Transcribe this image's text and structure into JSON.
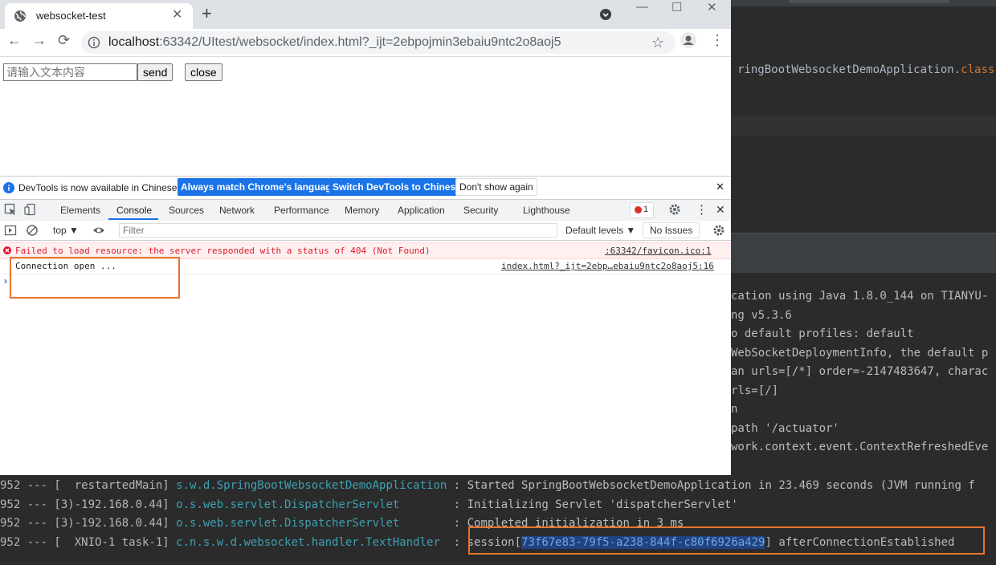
{
  "browser": {
    "tab_title": "websocket-test",
    "tab_close": "✕",
    "new_tab": "+",
    "url_host": "localhost",
    "url_rest": ":63342/UItest/websocket/index.html?_ijt=2ebpojmin3ebaiu9ntc2o8aoj5",
    "window_controls": {
      "minimize": "—",
      "maximize": "☐",
      "close": "✕"
    },
    "nav": {
      "back": "←",
      "forward": "→",
      "reload": "⟳",
      "star": "☆",
      "menu": "⋮"
    }
  },
  "page": {
    "input_placeholder": "请输入文本内容",
    "send_label": "send",
    "close_label": "close"
  },
  "devtools": {
    "info_text": "DevTools is now available in Chinese!",
    "btn_match": "Always match Chrome's language",
    "btn_switch": "Switch DevTools to Chinese",
    "btn_dont_show": "Don't show again",
    "info_close": "✕",
    "tabs": [
      "Elements",
      "Console",
      "Sources",
      "Network",
      "Performance",
      "Memory",
      "Application",
      "Security",
      "Lighthouse"
    ],
    "error_count": "1",
    "context": "top ▼",
    "filter_placeholder": "Filter",
    "levels": "Default levels ▼",
    "no_issues": "No Issues",
    "close": "✕",
    "menu": "⋮",
    "console": {
      "error_text": "Failed to load resource: the server responded with a status of 404 (Not Found)",
      "error_src": ":63342/favicon.ico:1",
      "log_text": "Connection open ...",
      "log_src": "index.html?_ijt=2ebp…ebaiu9ntc2o8aoj5:16",
      "prompt": "›"
    }
  },
  "ide": {
    "code_line": {
      "text": "ringBootWebsocketDemoApplication.",
      "keyword": "class,"
    },
    "right_log_fragments": [
      "cation using Java 1.8.0_144 on TIANYU-",
      "ng v5.3.6",
      "o default profiles: default",
      "WebSocketDeploymentInfo, the default p",
      "an urls=[/*] order=-2147483647, charac",
      "rls=[/]",
      "n",
      "path '/actuator'",
      "work.context.event.ContextRefreshedEve"
    ],
    "bottom_logs": [
      {
        "pid": "952 --- [  restartedMain] ",
        "logger": "s.w.d.SpringBootWebsocketDemoApplication",
        "msg": " : Started SpringBootWebsocketDemoApplication in 23.469 seconds (JVM running f"
      },
      {
        "pid": "952 --- [3)-192.168.0.44] ",
        "logger": "o.s.web.servlet.DispatcherServlet       ",
        "msg": " : Initializing Servlet 'dispatcherServlet'"
      },
      {
        "pid": "952 --- [3)-192.168.0.44] ",
        "logger": "o.s.web.servlet.DispatcherServlet       ",
        "msg": " : Completed initialization in 3 ms"
      }
    ],
    "session_log": {
      "pid": "952 --- [  XNIO-1 task-1] ",
      "logger": "c.n.s.w.d.websocket.handler.TextHandler ",
      "prefix": " : session[",
      "session_id": "73f67e83-79f5-a238-844f-c80f6926a429",
      "suffix": "] afterConnectionEstablished"
    }
  },
  "colors": {
    "accent_blue": "#1a73e8",
    "error_red": "#e3182d",
    "highlight_orange": "#e8742e",
    "ide_bg": "#2b2b2b",
    "ide_logger": "#3d9fb0"
  }
}
